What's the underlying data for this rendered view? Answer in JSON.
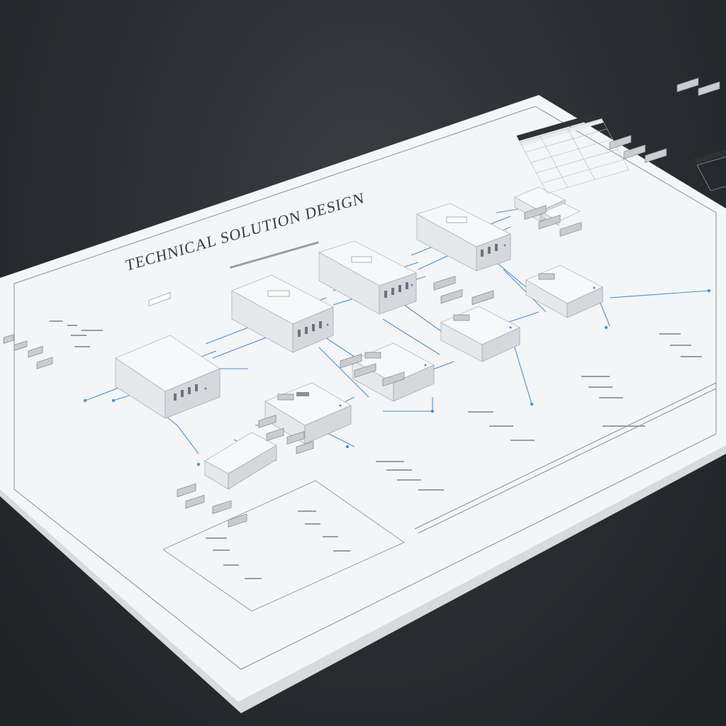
{
  "diagram": {
    "title": "TECHNICAL SOLUTION DESIGN"
  },
  "colors": {
    "background": "#2a2c31",
    "paper": "#f4f5f6",
    "connector": "#4a90d9",
    "server": "#e6e8eb"
  },
  "icons": [
    "server-icon",
    "network-switch-icon",
    "storage-unit-icon"
  ]
}
